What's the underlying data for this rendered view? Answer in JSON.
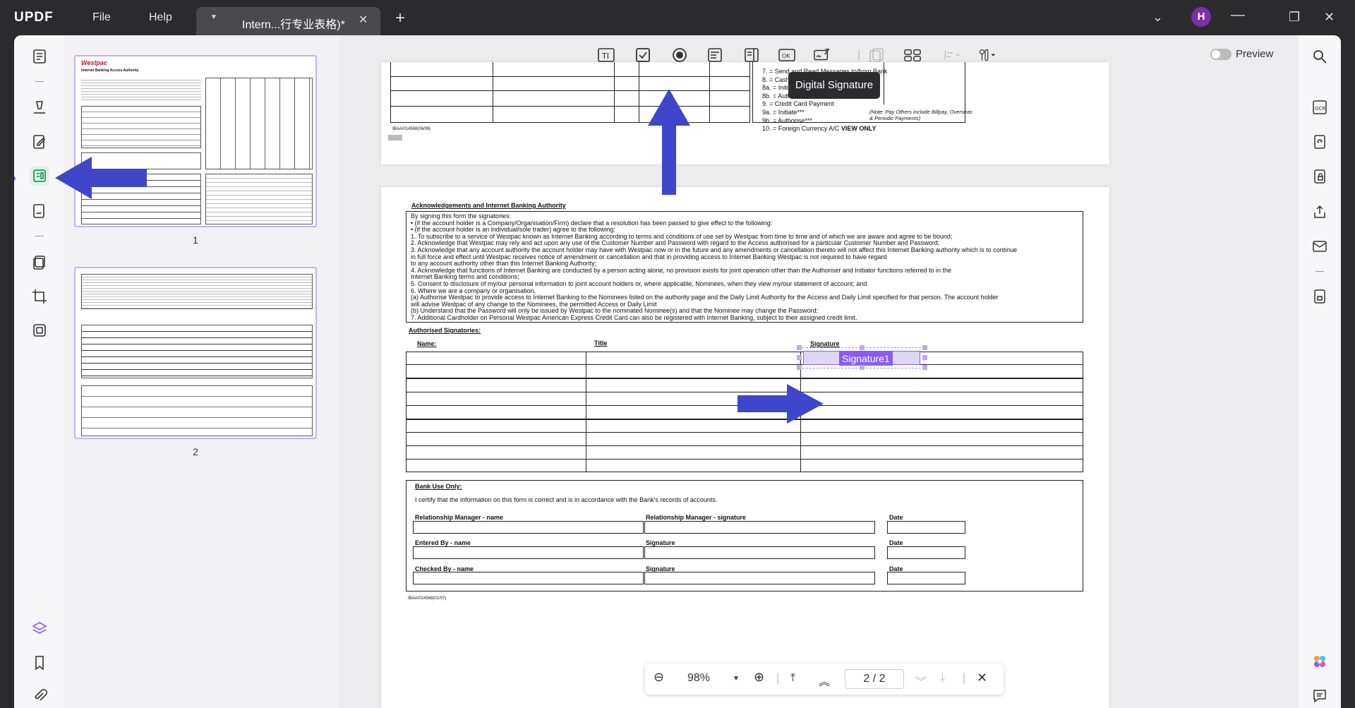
{
  "app": {
    "logo_text": "UPDF",
    "menu_file": "File",
    "menu_help": "Help",
    "tab_title": "Intern...行专业表格)*",
    "avatar_initial": "H",
    "accent": "#8a5cf6"
  },
  "toolbar": {
    "tooltip": "Digital Signature",
    "preview_label": "Preview"
  },
  "thumbnails": {
    "page1_label": "1",
    "page2_label": "2",
    "westpac": "Westpac",
    "ib_title": "Internet Banking Access Authority"
  },
  "page1_fragment": {
    "form_id": "IBAA/014568(06/09)",
    "list": [
      "7.   = Send and Read Messages to/from Bank",
      "8.   = Cash Advance",
      "8a. = Initiate***",
      "8b. = Authorise***",
      "9.   = Credit Card Payment",
      "9a. = Initiate***",
      "9b. = Authorise***"
    ],
    "item10": "10. = Foreign Currency A/C",
    "item10_bold": "VIEW ONLY",
    "note": "(Note: Pay Others include Billpay, Overseas",
    "note2": "& Periodic Payments)"
  },
  "page2": {
    "ack_title": "Acknowledgements and Internet Banking Authority",
    "ack_lines": [
      "By signing this form the signatories:",
      "      •     (if the account holder is a Company/Organisation/Firm) declare that a resolution has been passed to give effect to the following:",
      "      •     (if the account holder is an individual/sole trader) agree to the following:",
      "1. To subscribe to a service of Westpac known as Internet Banking according to terms and conditions of use set by Westpac from time to time and of which we are aware and agree to be bound;",
      "2. Acknowledge that Westpac may rely and act upon any use of the Customer Number and Password with regard to the Access authorised for a particular Customer Number and Password;",
      "3. Acknowledge that any account authority the account holder may have with Westpac now or in the future and any amendments or cancellation thereto will not affect this Internet Banking authority  which is to  continue",
      "    in full force and effect until Westpac receives notice of amendment or cancellation and that in providing access to Internet Banking Westpac is not required to have regard",
      "    to any account authority other than this Internet Banking Authority;",
      "4. Acknowledge that functions of Internet Banking are conducted by a person acting alone, no provision exists for joint operation other than the Authoriser and Initiator functions referred to in the",
      "    Internet Banking terms and conditions;",
      "5. Consent to disclosure of my/our personal information to joint account holders or, where applicable, Nominees, when they view my/our statement of account; and",
      "6. Where we are a company or organisation,",
      "         (a) Authorise Westpac to provide access to Internet Banking to the Nominees listed on the authority page and the Daily Limit Authority for the Access and Daily Limit specified for that person. The account holder",
      "                will advise Westpac of any change to the Nominees, the permitted Access or Daily Limit",
      "         (b) Understand that the Password will only be issued by Westpac to the nominated Nominee(s) and that the Nominee may change the Password;",
      "7. Additional Cardholder on Personal Westpac American Express Credit Card can also be registered with Internet Banking, subject to their assigned credit limit."
    ],
    "auth_title": "Authorised Signatories:",
    "col_name": "Name:",
    "col_title": "Title",
    "col_signature": "Signature",
    "sig_field": "Signature1",
    "bank_title": "Bank Use Only:",
    "bank_certify": "I certify that the information on this form is correct and is in accordance with the Bank's records of accounts.",
    "rm_name": "Relationship Manager - name",
    "rm_sig": "Relationship Manager - signature",
    "date": "Date",
    "entered_name": "Entered By - name",
    "signature": "Signature",
    "checked_name": "Checked By - name",
    "form_id": "IBAA/014568(01/07)"
  },
  "zoom": {
    "level": "98%",
    "current_page": "2",
    "separator": "/",
    "total_pages": "2"
  }
}
